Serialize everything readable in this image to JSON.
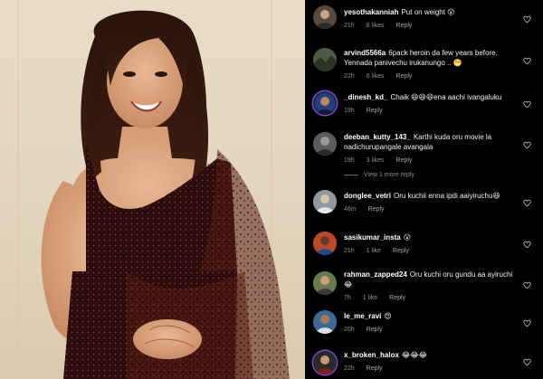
{
  "post": {
    "photo_icon": "woman-in-sequined-saree-photo"
  },
  "comments": [
    {
      "username": "yesothakanniah",
      "text": "Put on weight 😮",
      "time": "21h",
      "likes": "8 likes",
      "reply": "Reply",
      "avatar_color": "#5a4a3e",
      "ring": false
    },
    {
      "username": "arvind5566a",
      "text": "6pack heroin da few years before. Yennada panivechu irukanungo .. 😬",
      "time": "22h",
      "likes": "6 likes",
      "reply": "Reply",
      "avatar_color": "#3a4236",
      "ring": false
    },
    {
      "username": "_dinesh_kd_",
      "text": "Chaik 😆😆😆ena aachi ivangaluku",
      "time": "19h",
      "likes": "",
      "reply": "Reply",
      "avatar_color": "#1c2a4a",
      "ring": true
    },
    {
      "username": "deeban_kutty_143_",
      "text": "Karthi kuda oru movie la nadichurupangale avangala",
      "time": "19h",
      "likes": "3 likes",
      "reply": "Reply",
      "avatar_color": "#4a4a4a",
      "ring": false
    },
    {
      "username": "donglee_vetri",
      "text": "Oru kuchii enna ipdi aaiyiruchu😆",
      "time": "46m",
      "likes": "",
      "reply": "Reply",
      "avatar_color": "#6f7e86",
      "ring": false
    },
    {
      "username": "sasikumar_insta",
      "text": "😮",
      "time": "21h",
      "likes": "1 like",
      "reply": "Reply",
      "avatar_color": "#8a3b2a",
      "ring": false
    },
    {
      "username": "rahman_zapped24",
      "text": "Oru kuchi oru gundu aa ayiruchi 😂",
      "time": "7h",
      "likes": "1 like",
      "reply": "Reply",
      "avatar_color": "#4c5a3a",
      "ring": false
    },
    {
      "username": "le_me_ravi",
      "text": "😍",
      "time": "20h",
      "likes": "",
      "reply": "Reply",
      "avatar_color": "#2d4a6a",
      "ring": false
    },
    {
      "username": "x_broken_halox",
      "text": "😂😂😂",
      "time": "22h",
      "likes": "",
      "reply": "Reply",
      "avatar_color": "#6a1e1e",
      "ring": true
    }
  ],
  "view_more": "View 1 more reply",
  "icons": {
    "like": "heart-outline-icon",
    "avatar": "user-avatar"
  },
  "colors": {
    "background": "#000000",
    "username": "#ffffff",
    "text": "#f2f2f2",
    "meta": "#8e8e8e",
    "story_ring": "#7e44d6"
  }
}
